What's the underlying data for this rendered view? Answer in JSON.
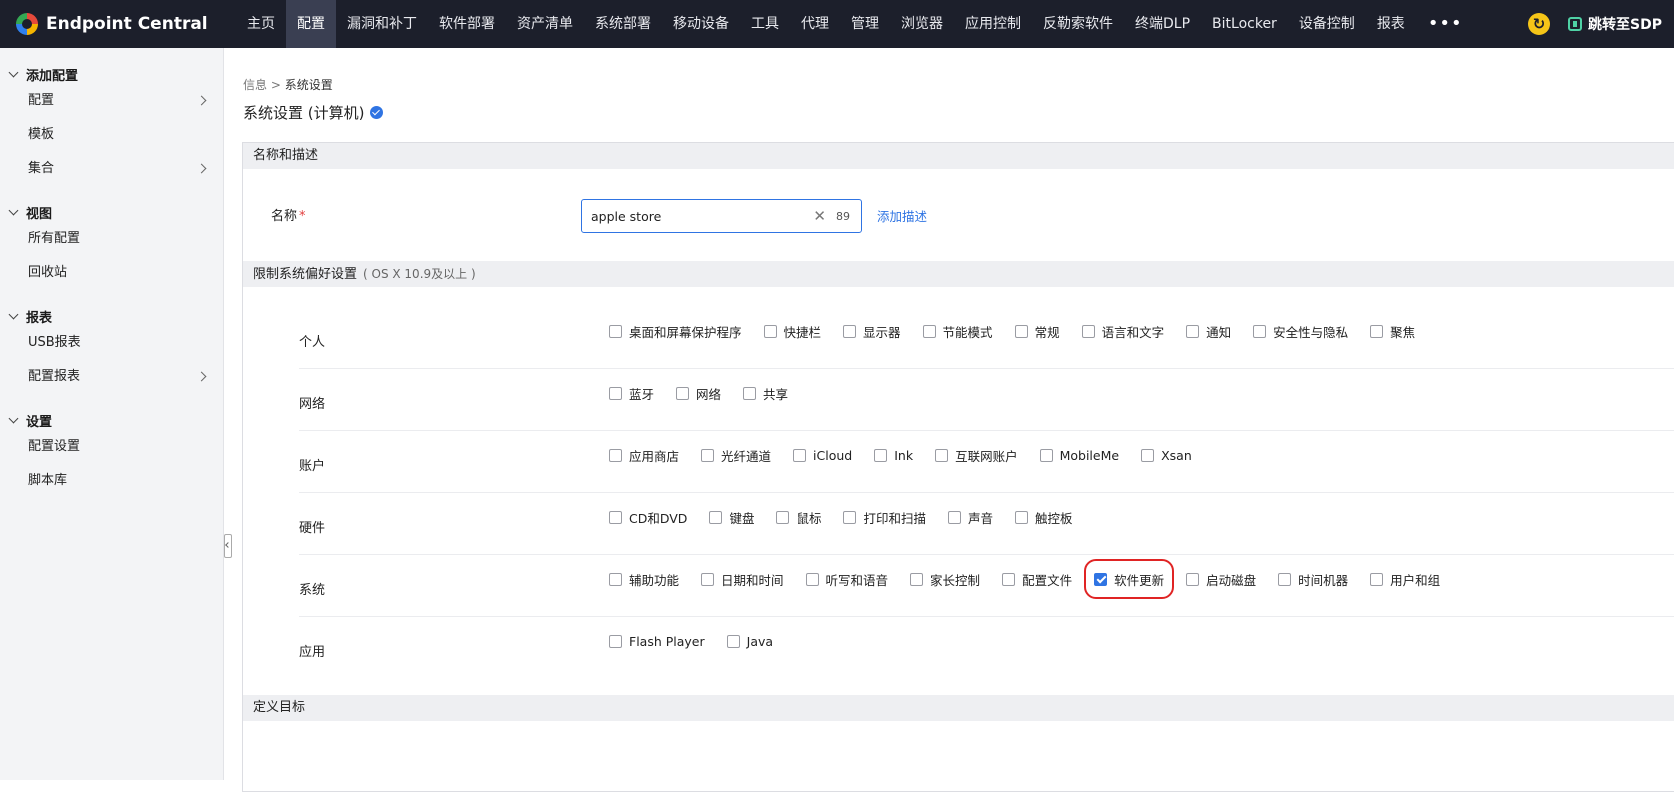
{
  "brand": {
    "name": "Endpoint Central"
  },
  "nav": {
    "items": [
      "主页",
      "配置",
      "漏洞和补丁",
      "软件部署",
      "资产清单",
      "系统部署",
      "移动设备",
      "工具",
      "代理",
      "管理",
      "浏览器",
      "应用控制",
      "反勒索软件",
      "终端DLP",
      "BitLocker",
      "设备控制",
      "报表"
    ],
    "active": "配置",
    "more": "•••",
    "sdp_link": "跳转至SDP"
  },
  "sidebar": {
    "groups": [
      {
        "title": "添加配置",
        "items": [
          {
            "label": "配置",
            "expandable": true
          },
          {
            "label": "模板",
            "expandable": false
          },
          {
            "label": "集合",
            "expandable": true
          }
        ]
      },
      {
        "title": "视图",
        "items": [
          {
            "label": "所有配置",
            "expandable": false
          },
          {
            "label": "回收站",
            "expandable": false
          }
        ]
      },
      {
        "title": "报表",
        "items": [
          {
            "label": "USB报表",
            "expandable": false
          },
          {
            "label": "配置报表",
            "expandable": true
          }
        ]
      },
      {
        "title": "设置",
        "items": [
          {
            "label": "配置设置",
            "expandable": false
          },
          {
            "label": "脚本库",
            "expandable": false
          }
        ]
      }
    ]
  },
  "breadcrumb": {
    "parent": "信息",
    "separator": ">",
    "current": "系统设置"
  },
  "page_title": "系统设置 (计算机)",
  "form": {
    "name_section": "名称和描述",
    "name_label": "名称",
    "required_mark": "*",
    "name_value": "apple store",
    "char_count": "89",
    "add_description": "添加描述",
    "restrict_section": "限制系统偏好设置",
    "restrict_section_note": "( OS X 10.9及以上 )",
    "target_section": "定义目标"
  },
  "preferences": [
    {
      "category": "个人",
      "options": [
        {
          "label": "桌面和屏幕保护程序",
          "checked": false
        },
        {
          "label": "快捷栏",
          "checked": false
        },
        {
          "label": "显示器",
          "checked": false
        },
        {
          "label": "节能模式",
          "checked": false
        },
        {
          "label": "常规",
          "checked": false
        },
        {
          "label": "语言和文字",
          "checked": false
        },
        {
          "label": "通知",
          "checked": false
        },
        {
          "label": "安全性与隐私",
          "checked": false
        },
        {
          "label": "聚焦",
          "checked": false
        }
      ]
    },
    {
      "category": "网络",
      "options": [
        {
          "label": "蓝牙",
          "checked": false
        },
        {
          "label": "网络",
          "checked": false
        },
        {
          "label": "共享",
          "checked": false
        }
      ]
    },
    {
      "category": "账户",
      "options": [
        {
          "label": "应用商店",
          "checked": false
        },
        {
          "label": "光纤通道",
          "checked": false
        },
        {
          "label": "iCloud",
          "checked": false
        },
        {
          "label": "Ink",
          "checked": false
        },
        {
          "label": "互联网账户",
          "checked": false
        },
        {
          "label": "MobileMe",
          "checked": false
        },
        {
          "label": "Xsan",
          "checked": false
        }
      ]
    },
    {
      "category": "硬件",
      "options": [
        {
          "label": "CD和DVD",
          "checked": false
        },
        {
          "label": "键盘",
          "checked": false
        },
        {
          "label": "鼠标",
          "checked": false
        },
        {
          "label": "打印和扫描",
          "checked": false
        },
        {
          "label": "声音",
          "checked": false
        },
        {
          "label": "触控板",
          "checked": false
        }
      ]
    },
    {
      "category": "系统",
      "options": [
        {
          "label": "辅助功能",
          "checked": false
        },
        {
          "label": "日期和时间",
          "checked": false
        },
        {
          "label": "听写和语音",
          "checked": false
        },
        {
          "label": "家长控制",
          "checked": false
        },
        {
          "label": "配置文件",
          "checked": false
        },
        {
          "label": "软件更新",
          "checked": true,
          "highlighted": true
        },
        {
          "label": "启动磁盘",
          "checked": false
        },
        {
          "label": "时间机器",
          "checked": false
        },
        {
          "label": "用户和组",
          "checked": false
        }
      ]
    },
    {
      "category": "应用",
      "options": [
        {
          "label": "Flash Player",
          "checked": false
        },
        {
          "label": "Java",
          "checked": false
        }
      ]
    }
  ],
  "colors": {
    "topbar": "#1c1f2b",
    "accent": "#2f74e3",
    "highlight_border": "#e02424",
    "sidebar_bg": "#f3f4f6"
  }
}
